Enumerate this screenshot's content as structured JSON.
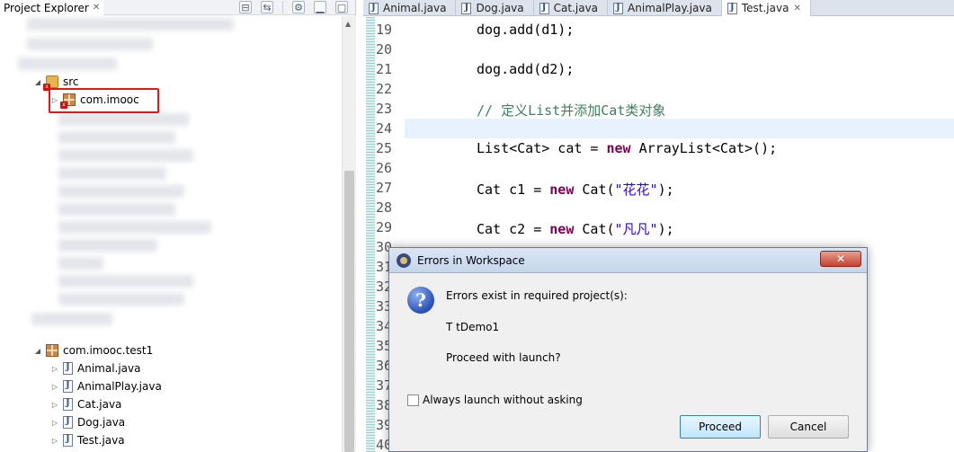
{
  "explorer": {
    "title": "Project Explorer",
    "close_glyph": "✕",
    "tools": [
      "collapse-all-icon",
      "link-with-editor-icon",
      "view-menu-icon",
      "minimize-icon",
      "maximize-icon"
    ],
    "tool_glyphs": [
      "⊟",
      "⇆",
      "⚙",
      "▁",
      "▢"
    ],
    "src_label": "src",
    "selected_package": "com.imooc",
    "package2": "com.imooc.test1",
    "files": [
      "Animal.java",
      "AnimalPlay.java",
      "Cat.java",
      "Dog.java",
      "Test.java"
    ],
    "expand_glyph": "◢",
    "collapse_glyph": "▷"
  },
  "editor": {
    "tabs": [
      "Animal.java",
      "Dog.java",
      "Cat.java",
      "AnimalPlay.java",
      "Test.java"
    ],
    "active_tab": "Test.java",
    "tab_close_glyph": "✕",
    "line_numbers": [
      "19",
      "20",
      "21",
      "22",
      "23",
      "24",
      "25",
      "26",
      "27",
      "28",
      "29",
      "30",
      "31",
      "32",
      "33",
      "34",
      "35",
      "36",
      "37",
      "38",
      "39",
      "40"
    ],
    "code": {
      "l19": "dog.add(d1);",
      "l21": "dog.add(d2);",
      "l23": "// 定义List并添加Cat类对象",
      "l25_a": "List<Cat> cat = ",
      "l25_kw": "new",
      "l25_b": " ArrayList<Cat>();",
      "l27_a": "Cat c1 = ",
      "l27_kw": "new",
      "l27_b": " Cat(",
      "l27_str": "\"花花\"",
      "l27_c": ");",
      "l29_a": "Cat c2 = ",
      "l29_kw": "new",
      "l29_b": " Cat(",
      "l29_str": "\"凡凡\"",
      "l29_c": ");"
    }
  },
  "dialog": {
    "title": "Errors in Workspace",
    "close_glyph": "✕",
    "question_glyph": "?",
    "message": "Errors exist in required project(s):",
    "project": "T  tDemo1",
    "question": "Proceed with launch?",
    "checkbox_label": "Always launch without asking",
    "proceed_label": "Proceed",
    "cancel_label": "Cancel"
  }
}
